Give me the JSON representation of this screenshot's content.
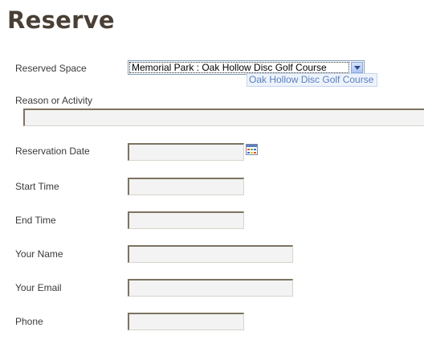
{
  "page": {
    "title": "Reserve"
  },
  "form": {
    "reserved_space": {
      "label": "Reserved Space",
      "selected": "Memorial Park : Oak Hollow Disc Golf Course",
      "dropdown_option": "Oak Hollow Disc Golf Course"
    },
    "reason": {
      "label": "Reason or Activity",
      "value": ""
    },
    "reservation_date": {
      "label": "Reservation Date",
      "value": ""
    },
    "start_time": {
      "label": "Start Time",
      "value": ""
    },
    "end_time": {
      "label": "End Time",
      "value": ""
    },
    "your_name": {
      "label": "Your Name",
      "value": ""
    },
    "your_email": {
      "label": "Your Email",
      "value": ""
    },
    "phone": {
      "label": "Phone",
      "value": ""
    }
  },
  "colors": {
    "title": "#4a3f35",
    "input_bg": "#f3f3f3",
    "input_border": "#7d7361"
  },
  "icons": {
    "date_picker": "calendar-icon",
    "select_arrow": "chevron-down-icon"
  }
}
